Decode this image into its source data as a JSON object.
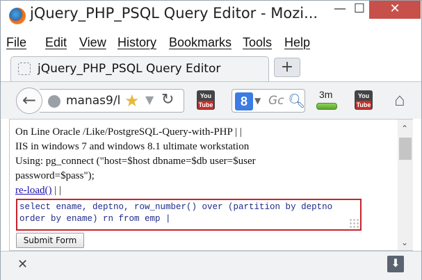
{
  "window": {
    "title": "jQuery_PHP_PSQL Query Editor - Mozi...",
    "minimize_glyph": "—",
    "maximize_glyph": "☐",
    "close_glyph": "✕"
  },
  "menu": {
    "items": [
      {
        "label": "File"
      },
      {
        "label": "Edit"
      },
      {
        "label": "View"
      },
      {
        "label": "History"
      },
      {
        "label": "Bookmarks"
      },
      {
        "label": "Tools"
      },
      {
        "label": "Help"
      }
    ]
  },
  "tabs": {
    "active_label": "jQuery_PHP_PSQL Query Editor",
    "new_tab_glyph": "+"
  },
  "navbar": {
    "back_glyph": "🡐",
    "url": "manas9/l",
    "search_placeholder": "Gc",
    "google_letter": "8",
    "three_m_label": "3m",
    "youtube_label_top": "You",
    "youtube_label_bottom": "Tube"
  },
  "page": {
    "line1": "On Line Oracle /Like/PostgreSQL-Query-with-PHP | |",
    "line2": "IIS in windows 7 and windows 8.1 ultimate workstation",
    "line3": "Using: pg_connect (\"host=$host dbname=$db user=$user",
    "line4": "password=$pass\");",
    "reload_link": "re-load()",
    "reload_suffix": "| |",
    "query_text": "select ename, deptno, row_number() over (partition by deptno order by ename) rn from emp |",
    "submit_label": "Submit Form"
  },
  "colors": {
    "query_border": "#c8222a",
    "link": "#1a0dab",
    "close_button": "#c7504a"
  },
  "icons": {
    "app": "firefox-icon",
    "globe": "globe-icon",
    "star": "star-icon",
    "reload": "reload-icon",
    "home": "home-icon",
    "download": "download-icon"
  }
}
